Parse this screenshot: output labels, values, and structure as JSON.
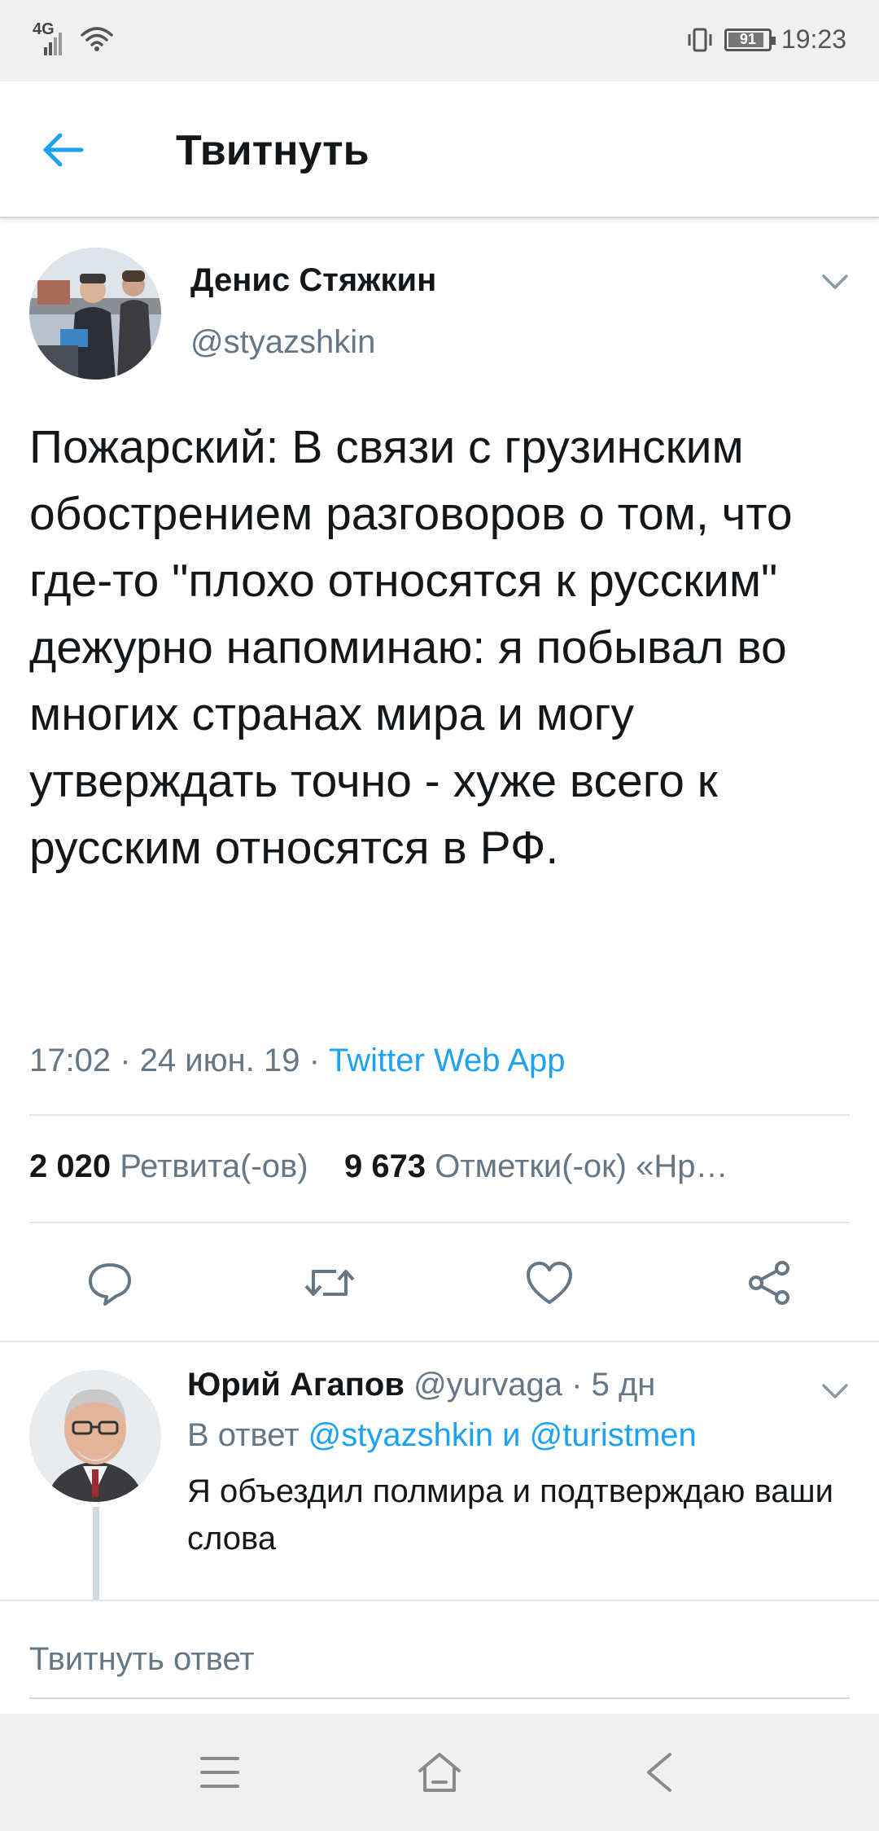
{
  "status_bar": {
    "network": "4G",
    "battery": "91",
    "battery_level": 0.91,
    "time": "19:23"
  },
  "header": {
    "title": "Твитнуть",
    "back_icon": "arrow-left-icon",
    "accent_color": "#1da1f2"
  },
  "tweet": {
    "author_name": "Денис Стяжкин",
    "author_handle": "@styazshkin",
    "text": "Пожарский: В связи с грузинским обострением разговоров о том, что где-то \"плохо относятся к русским\" дежурно напоминаю: я побывал во многих странах мира и могу утверждать точно - хуже всего к русским относятся в РФ.",
    "time": "17:02",
    "date": "24 июн. 19",
    "separator": "·",
    "source": "Twitter Web App",
    "retweets_count": "2 020",
    "retweets_label": "Ретвита(-ов)",
    "likes_count": "9 673",
    "likes_label": "Отметки(-ок) «Нр…",
    "actions": [
      "reply-icon",
      "retweet-icon",
      "like-icon",
      "share-icon"
    ]
  },
  "reply": {
    "author_name": "Юрий Агапов",
    "author_handle": "@yurvaga",
    "age": "5 дн",
    "reply_prefix": "В ответ",
    "reply_to_1": "@styazshkin",
    "reply_and": "и",
    "reply_to_2": "@turistmen",
    "text": "Я объездил полмира и подтверждаю ваши слова"
  },
  "compose": {
    "placeholder": "Твитнуть ответ"
  },
  "nav": {
    "icons": [
      "menu-icon",
      "home-icon",
      "back-triangle-icon"
    ]
  }
}
